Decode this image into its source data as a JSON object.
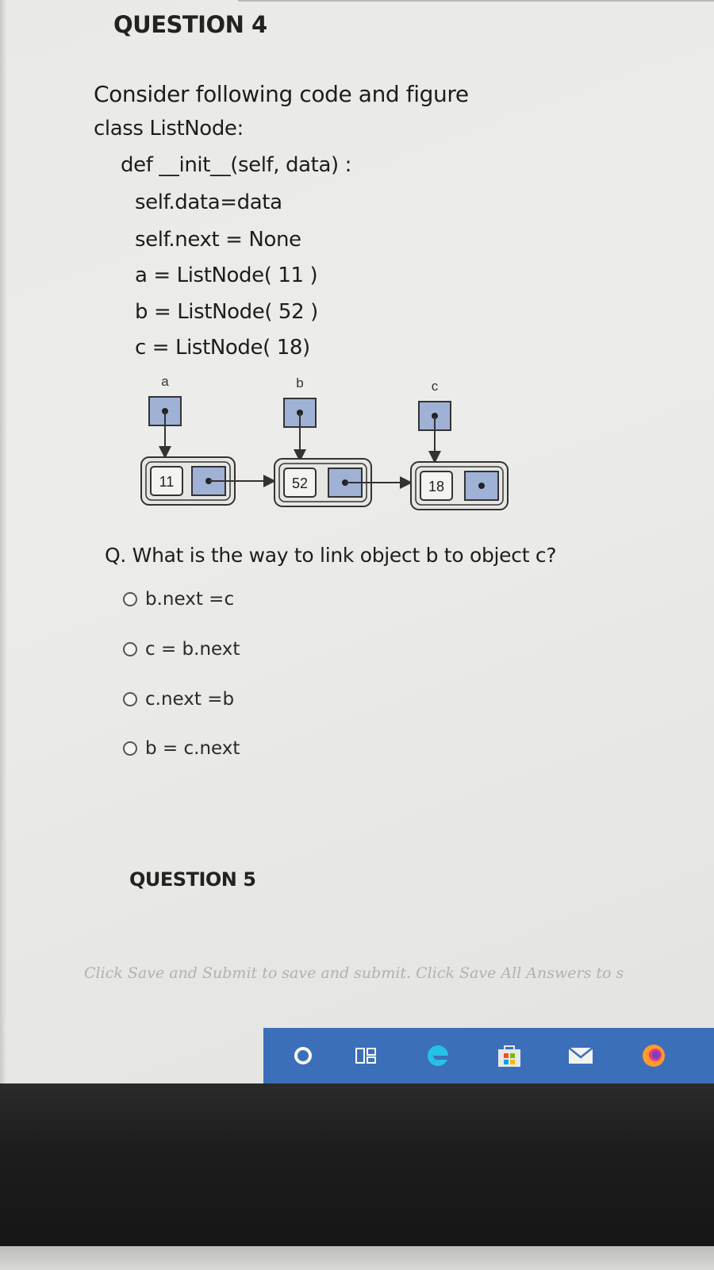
{
  "question4": {
    "title": "QUESTION 4",
    "intro": "Consider following code and figure",
    "code": {
      "class_line": "class ListNode:",
      "def_line": "def __init__(self, data) :",
      "data_line": "self.data=data",
      "next_line": "self.next = None",
      "a_line": "a = ListNode( 11 )",
      "b_line": "b = ListNode( 52 )",
      "c_line": "c = ListNode( 18)"
    },
    "figure": {
      "vars": [
        "a",
        "b",
        "c"
      ],
      "values": [
        "11",
        "52",
        "18"
      ]
    },
    "question_text": "Q. What is the way to link object b to object c?",
    "options": [
      "b.next =c",
      "c = b.next",
      "c.next =b",
      "b = c.next"
    ]
  },
  "question5": {
    "title": "QUESTION 5"
  },
  "footer": {
    "note": "Click Save and Submit to save and submit. Click Save All Answers to s"
  },
  "taskbar": {
    "icons": [
      "cortana-icon",
      "task-view-icon",
      "edge-icon",
      "store-icon",
      "mail-icon",
      "firefox-icon"
    ],
    "color": "#3b6fb9"
  },
  "colors": {
    "node_fill": "#9fb2d6",
    "node_border": "#3a3a3a"
  }
}
